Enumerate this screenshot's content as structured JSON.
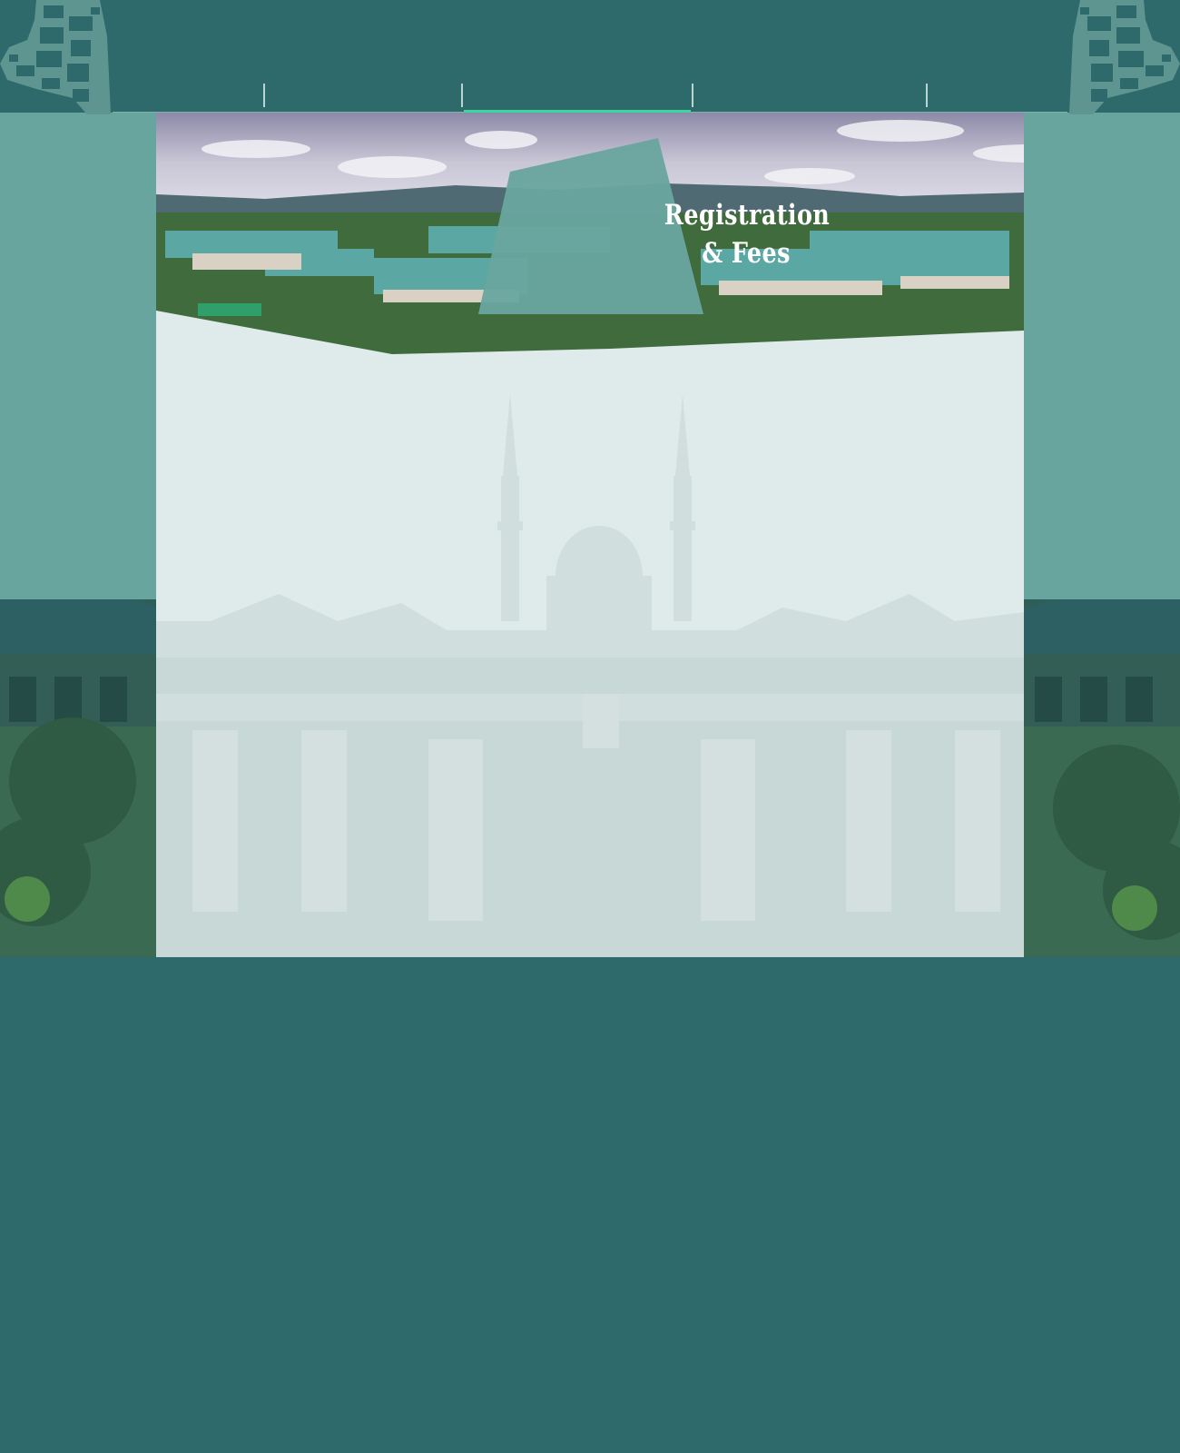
{
  "header": {
    "nav_items": [
      {
        "label": ""
      },
      {
        "label": ""
      },
      {
        "label": "",
        "active": true
      },
      {
        "label": ""
      },
      {
        "label": ""
      }
    ]
  },
  "hero": {
    "title_line1": "Registration",
    "title_line2": "& Fees"
  },
  "colors": {
    "header_bg": "#2e6a6b",
    "accent": "#3dd6a2",
    "panel_bg": "#deebea",
    "title_badge": "#6aa59f"
  },
  "icons": [
    "pixel-pattern-left",
    "pixel-pattern-right"
  ]
}
